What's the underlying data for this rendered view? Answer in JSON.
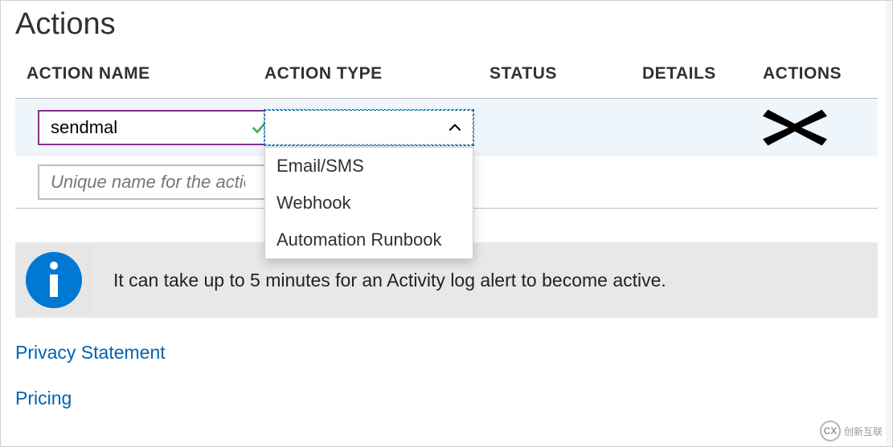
{
  "section_title": "Actions",
  "headers": {
    "name": "ACTION NAME",
    "type": "ACTION TYPE",
    "status": "STATUS",
    "details": "DETAILS",
    "actions": "ACTIONS"
  },
  "rows": {
    "first": {
      "name_value": "sendmal",
      "type_value": ""
    },
    "second": {
      "name_placeholder": "Unique name for the action"
    }
  },
  "dropdown_options": {
    "0": "Email/SMS",
    "1": "Webhook",
    "2": "Automation Runbook"
  },
  "info_message": "It can take up to 5 minutes for an Activity log alert to become active.",
  "links": {
    "privacy": "Privacy Statement",
    "pricing": "Pricing"
  },
  "watermark": {
    "logo": "CX",
    "text": "创新互联"
  }
}
